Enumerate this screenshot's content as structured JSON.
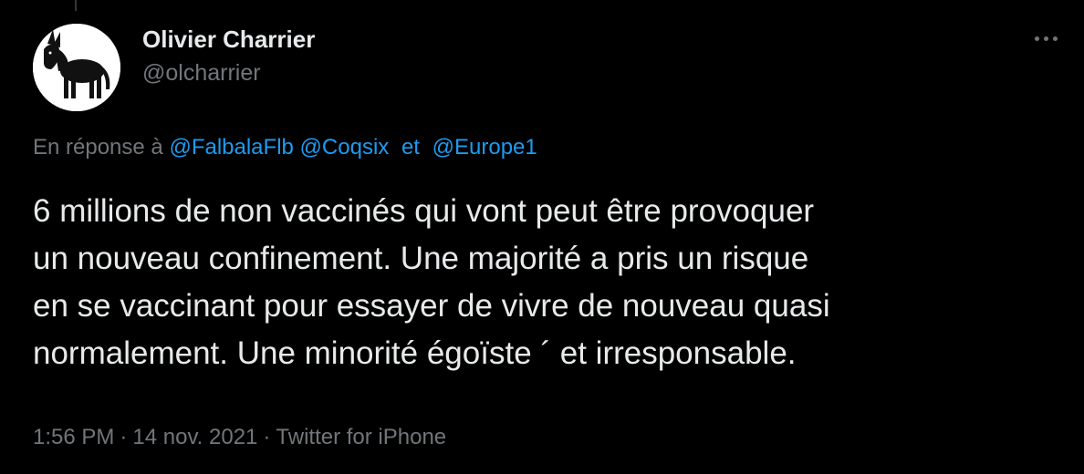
{
  "author": {
    "display_name": "Olivier Charrier",
    "handle": "@olcharrier",
    "avatar_icon": "donkey-icon"
  },
  "reply_to": {
    "prefix": "En réponse à",
    "mentions": [
      "@FalbalaFlb",
      "@Coqsix",
      "@Europe1"
    ],
    "conjunction": "et"
  },
  "tweet": {
    "lines": [
      "6 millions de non vaccinés qui vont peut être provoquer",
      "un nouveau confinement. Une majorité a pris un risque",
      "en se vaccinant pour essayer de vivre de nouveau quasi",
      "normalement. Une minorité égoïste ´ et irresponsable."
    ]
  },
  "meta": {
    "time": "1:56 PM",
    "separator": "·",
    "date": "14 nov. 2021",
    "source": "Twitter for iPhone"
  },
  "colors": {
    "background": "#000000",
    "text": "#e7e9ea",
    "muted": "#71767b",
    "link": "#1d9bf0"
  }
}
